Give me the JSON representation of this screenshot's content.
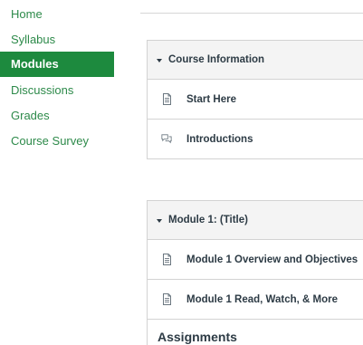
{
  "course_nav": {
    "items": [
      {
        "label": "Home",
        "active": false
      },
      {
        "label": "Syllabus",
        "active": false
      },
      {
        "label": "Modules",
        "active": true
      },
      {
        "label": "Discussions",
        "active": false
      },
      {
        "label": "Grades",
        "active": false
      },
      {
        "label": "Course Survey",
        "active": false
      }
    ]
  },
  "modules": [
    {
      "title": "Course Information",
      "items": [
        {
          "label": "Start Here",
          "icon": "document-icon"
        },
        {
          "label": "Introductions",
          "icon": "discussion-icon"
        }
      ]
    },
    {
      "title": "Module 1: (Title)",
      "items": [
        {
          "label": "Module 1 Overview and Objectives",
          "icon": "document-icon"
        },
        {
          "label": "Module 1 Read, Watch, & More",
          "icon": "document-icon"
        }
      ],
      "subheader": "Assignments"
    }
  ],
  "colors": {
    "nav_link": "#2d8a4a",
    "nav_active_bg": "#1d8a3e",
    "text": "#2d3b45",
    "border": "#d3d3d3",
    "header_bg": "#f4f4f4"
  }
}
